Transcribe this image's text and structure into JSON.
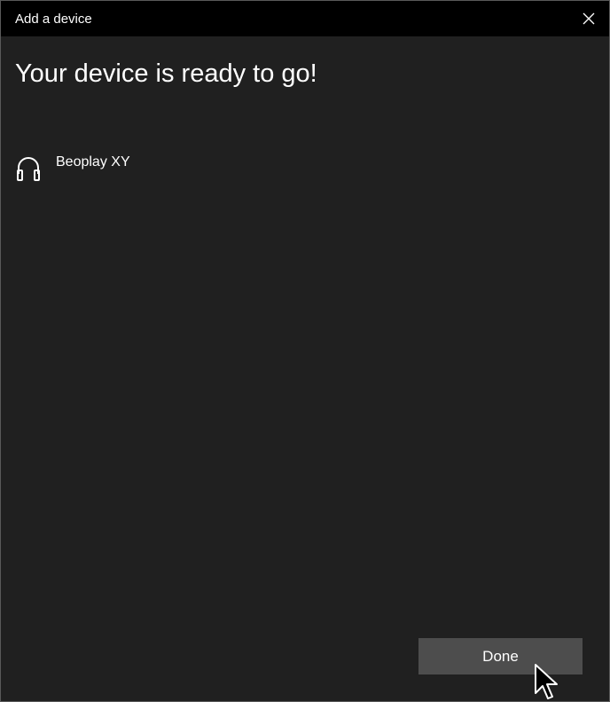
{
  "window": {
    "title": "Add a device"
  },
  "main": {
    "heading": "Your device is ready to go!",
    "device": {
      "name": "Beoplay XY",
      "icon": "headphones-icon"
    }
  },
  "footer": {
    "done_label": "Done"
  },
  "colors": {
    "titlebar_bg": "#000000",
    "window_bg": "#202020",
    "button_bg": "#4d4d4d",
    "text": "#ffffff"
  }
}
